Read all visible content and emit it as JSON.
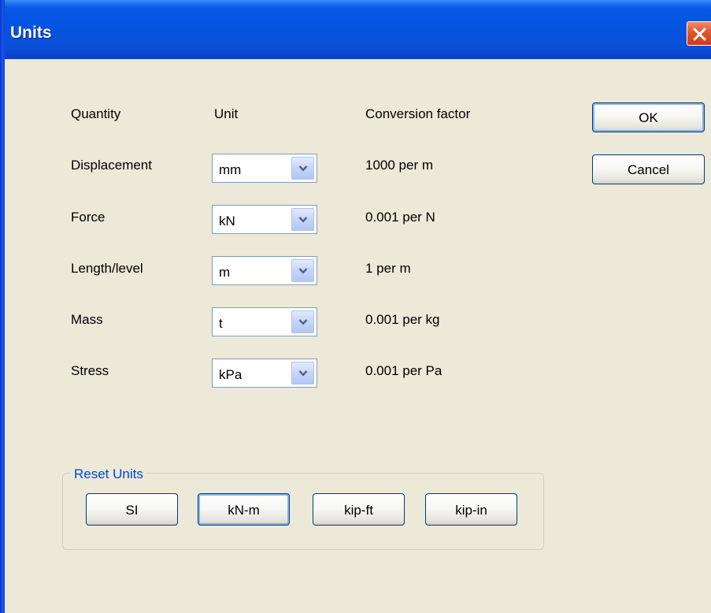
{
  "window": {
    "title": "Units"
  },
  "headers": {
    "quantity": "Quantity",
    "unit": "Unit",
    "conversion": "Conversion factor"
  },
  "rows": [
    {
      "quantity": "Displacement",
      "unit": "mm",
      "factor": "1000 per m"
    },
    {
      "quantity": "Force",
      "unit": "kN",
      "factor": "0.001 per N"
    },
    {
      "quantity": "Length/level",
      "unit": "m",
      "factor": "1 per m"
    },
    {
      "quantity": "Mass",
      "unit": "t",
      "factor": "0.001 per kg"
    },
    {
      "quantity": "Stress",
      "unit": "kPa",
      "factor": "0.001 per Pa"
    }
  ],
  "buttons": {
    "ok": "OK",
    "cancel": "Cancel"
  },
  "reset_units": {
    "label": "Reset Units",
    "buttons": [
      "SI",
      "kN-m",
      "kip-ft",
      "kip-in"
    ]
  },
  "icons": {
    "close": "close-icon",
    "dropdown": "chevron-down-icon"
  },
  "colors": {
    "titlebar": "#0554e3",
    "dialog_bg": "#ece9d8",
    "group_label": "#0046d5",
    "close_button": "#e1552d"
  }
}
